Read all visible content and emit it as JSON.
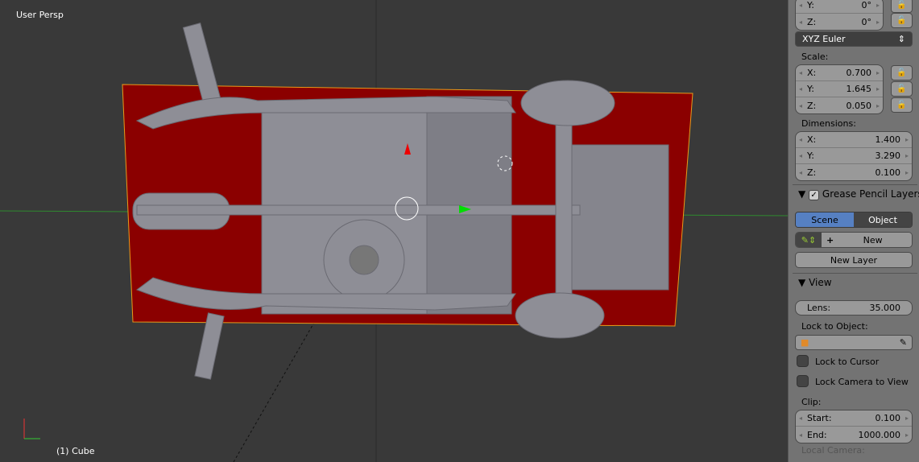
{
  "viewport": {
    "view_label": "User Persp",
    "object_label": "(1) Cube",
    "colors": {
      "plane": "#8b0000",
      "chassis": "#8e8e96",
      "bg": "#393939"
    }
  },
  "panel": {
    "rotation": {
      "y": "0°",
      "z": "0°",
      "mode": "XYZ Euler"
    },
    "scale": {
      "label": "Scale:",
      "x": "0.700",
      "y": "1.645",
      "z": "0.050"
    },
    "dimensions": {
      "label": "Dimensions:",
      "x": "1.400",
      "y": "3.290",
      "z": "0.100"
    },
    "axes": {
      "x": "X:",
      "y": "Y:",
      "z": "Z:"
    },
    "grease": {
      "title": "Grease Pencil Layers",
      "tab_scene": "Scene",
      "tab_object": "Object",
      "new_label": "New",
      "new_layer": "New Layer"
    },
    "view": {
      "title": "View",
      "lens_label": "Lens:",
      "lens": "35.000",
      "lock_object": "Lock to Object:",
      "lock_cursor": "Lock to Cursor",
      "lock_camera": "Lock Camera to View",
      "clip": "Clip:",
      "start_label": "Start:",
      "start": "0.100",
      "end_label": "End:",
      "end": "1000.000",
      "local_camera": "Local Camera:"
    }
  }
}
